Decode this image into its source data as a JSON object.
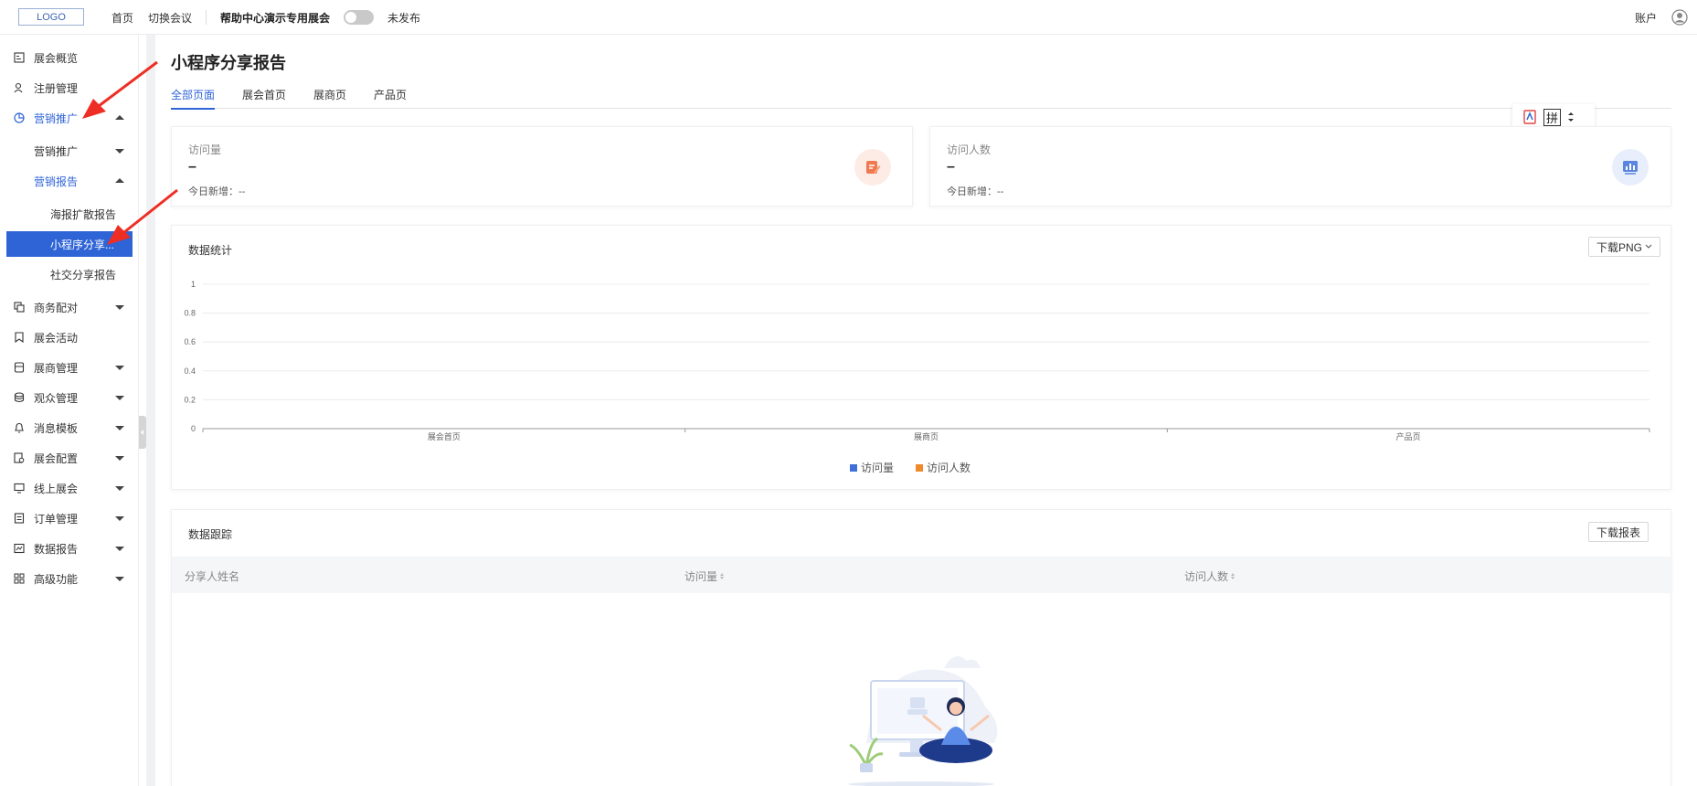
{
  "topbar": {
    "logo": "LOGO",
    "home": "首页",
    "switch_meeting": "切换会议",
    "expo_name": "帮助中心演示专用展会",
    "publish_status": "未发布",
    "account": "账户"
  },
  "sidebar": {
    "items": [
      {
        "label": "展会概览",
        "icon": "overview-icon",
        "caret": ""
      },
      {
        "label": "注册管理",
        "icon": "user-icon",
        "caret": ""
      },
      {
        "label": "营销推广",
        "icon": "pie-icon",
        "caret": "up"
      },
      {
        "label": "营销推广",
        "icon": "",
        "caret": "down"
      },
      {
        "label": "营销报告",
        "icon": "",
        "caret": "up"
      },
      {
        "label": "海报扩散报告",
        "icon": "",
        "caret": ""
      },
      {
        "label": "小程序分享...",
        "icon": "",
        "caret": ""
      },
      {
        "label": "社交分享报告",
        "icon": "",
        "caret": ""
      },
      {
        "label": "商务配对",
        "icon": "copy-icon",
        "caret": "down"
      },
      {
        "label": "展会活动",
        "icon": "bookmark-icon",
        "caret": ""
      },
      {
        "label": "展商管理",
        "icon": "store-icon",
        "caret": "down"
      },
      {
        "label": "观众管理",
        "icon": "database-icon",
        "caret": "down"
      },
      {
        "label": "消息模板",
        "icon": "bell-icon",
        "caret": "down"
      },
      {
        "label": "展会配置",
        "icon": "config-icon",
        "caret": "down"
      },
      {
        "label": "线上展会",
        "icon": "monitor-icon",
        "caret": "down"
      },
      {
        "label": "订单管理",
        "icon": "order-icon",
        "caret": "down"
      },
      {
        "label": "数据报告",
        "icon": "report-icon",
        "caret": "down"
      },
      {
        "label": "高级功能",
        "icon": "grid-icon",
        "caret": "down"
      }
    ]
  },
  "page": {
    "title": "小程序分享报告",
    "tabs": [
      "全部页面",
      "展会首页",
      "展商页",
      "产品页"
    ]
  },
  "float_tools": {
    "pin": "拼"
  },
  "stats": [
    {
      "label": "访问量",
      "value": "–",
      "today_label": "今日新增：",
      "today_value": "--"
    },
    {
      "label": "访问人数",
      "value": "–",
      "today_label": "今日新增：",
      "today_value": "--"
    }
  ],
  "stats_section": {
    "title": "数据统计",
    "download": "下载PNG"
  },
  "chart_data": {
    "type": "bar",
    "categories": [
      "展会首页",
      "展商页",
      "产品页"
    ],
    "series": [
      {
        "name": "访问量",
        "values": [
          0,
          0,
          0
        ],
        "color": "#3f6fd8"
      },
      {
        "name": "访问人数",
        "values": [
          0,
          0,
          0
        ],
        "color": "#ee8a2a"
      }
    ],
    "yticks": [
      "0",
      "0.2",
      "0.4",
      "0.6",
      "0.8",
      "1"
    ],
    "ylim": [
      0,
      1
    ],
    "grid": true,
    "legend": "bottom"
  },
  "tracking": {
    "title": "数据跟踪",
    "download": "下载报表",
    "columns": [
      "分享人姓名",
      "访问量",
      "访问人数"
    ]
  }
}
